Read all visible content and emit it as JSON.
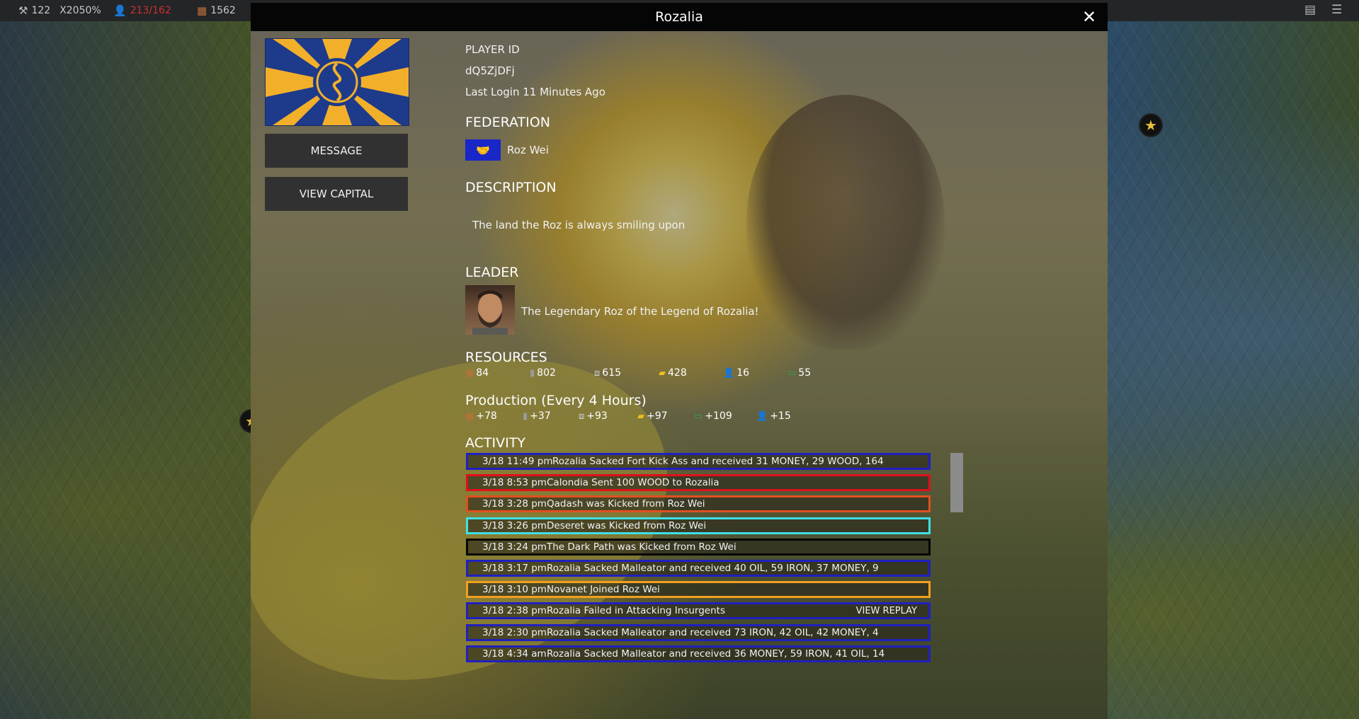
{
  "topbar": {
    "hammer_value": "122",
    "multiplier": "X2050%",
    "population": "213/162",
    "wood": "1562"
  },
  "modal": {
    "title": "Rozalia",
    "close_label": "✕"
  },
  "actions": {
    "message_label": "MESSAGE",
    "view_capital_label": "VIEW CAPITAL"
  },
  "player": {
    "id_label": "PLAYER ID",
    "id_value": "dQ5ZjDFj",
    "last_login": "Last Login 11 Minutes Ago"
  },
  "federation": {
    "heading": "FEDERATION",
    "name": "Roz Wei"
  },
  "description": {
    "heading": "DESCRIPTION",
    "text": "The land the Roz is always smiling upon"
  },
  "leader": {
    "heading": "LEADER",
    "title": "The Legendary Roz of the Legend of Rozalia!"
  },
  "resources": {
    "heading": "RESOURCES",
    "wood": "84",
    "oil": "802",
    "iron": "615",
    "gold": "428",
    "population": "16",
    "money": "55"
  },
  "production": {
    "heading": "Production (Every 4 Hours)",
    "wood": "+78",
    "oil": "+37",
    "iron": "+93",
    "gold": "+97",
    "money": "+109",
    "population": "+15"
  },
  "activity": {
    "heading": "ACTIVITY",
    "view_replay_label": "VIEW REPLAY",
    "items": [
      {
        "date": "3/18  11:49 pm",
        "text": "Rozalia Sacked Fort Kick Ass and received 31 MONEY, 29 WOOD, 164",
        "border": "#2020c0"
      },
      {
        "date": "3/18  8:53 pm",
        "text": "Calondia Sent 100 WOOD to Rozalia",
        "border": "#e0101a"
      },
      {
        "date": "3/18  3:28 pm",
        "text": "Qadash was Kicked from Roz Wei",
        "border": "#e05020"
      },
      {
        "date": "3/18  3:26 pm",
        "text": "Deseret was Kicked from Roz Wei",
        "border": "#3fe0e8"
      },
      {
        "date": "3/18  3:24 pm",
        "text": "The Dark Path was Kicked from Roz Wei",
        "border": "#050505"
      },
      {
        "date": "3/18  3:17 pm",
        "text": "Rozalia Sacked Malleator and received 40 OIL, 59 IRON, 37 MONEY, 9",
        "border": "#2020c0"
      },
      {
        "date": "3/18  3:10 pm",
        "text": "Novanet Joined Roz Wei",
        "border": "#f0a020"
      },
      {
        "date": "3/18  2:38 pm",
        "text": "Rozalia Failed in Attacking Insurgents",
        "border": "#2020c0"
      },
      {
        "date": "3/18  2:30 pm",
        "text": "Rozalia Sacked Malleator and received 73 IRON, 42 OIL, 42 MONEY, 4",
        "border": "#2020c0"
      },
      {
        "date": "3/18  4:34 am",
        "text": "Rozalia Sacked Malleator and received 36 MONEY, 59 IRON, 41 OIL, 14",
        "border": "#2020c0"
      }
    ]
  },
  "icons": {
    "hammer": "hammer-icon",
    "population": "person-icon",
    "wood": "wood-logs-icon",
    "oil": "oil-barrel-icon",
    "iron": "iron-ingot-icon",
    "gold": "gold-bar-icon",
    "money": "money-bill-icon",
    "federation": "handshake-icon",
    "close": "close-icon",
    "menu": "hamburger-menu-icon",
    "report": "document-icon"
  },
  "colors": {
    "federation_badge": "#1926c8",
    "flag_blue": "#1e3a8a",
    "flag_gold": "#f2b02a",
    "population_alert": "#cc3030"
  }
}
